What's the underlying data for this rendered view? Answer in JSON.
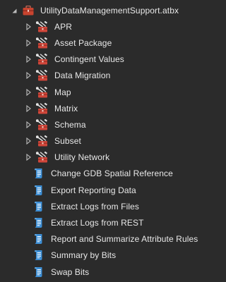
{
  "toolbox": {
    "name": "UtilityDataManagementSupport.atbx",
    "icon": "toolbox-icon",
    "expanded": true
  },
  "toolsets": [
    {
      "label": "APR",
      "icon": "toolset-icon"
    },
    {
      "label": "Asset Package",
      "icon": "toolset-icon"
    },
    {
      "label": "Contingent Values",
      "icon": "toolset-icon"
    },
    {
      "label": "Data Migration",
      "icon": "toolset-icon"
    },
    {
      "label": "Map",
      "icon": "toolset-icon"
    },
    {
      "label": "Matrix",
      "icon": "toolset-icon"
    },
    {
      "label": "Schema",
      "icon": "toolset-icon"
    },
    {
      "label": "Subset",
      "icon": "toolset-icon"
    },
    {
      "label": "Utility Network",
      "icon": "toolset-icon"
    }
  ],
  "scripts": [
    {
      "label": "Change GDB Spatial Reference",
      "icon": "script-tool-icon"
    },
    {
      "label": "Export Reporting Data",
      "icon": "script-tool-icon"
    },
    {
      "label": "Extract Logs from Files",
      "icon": "script-tool-icon"
    },
    {
      "label": "Extract Logs from REST",
      "icon": "script-tool-icon"
    },
    {
      "label": "Report and Summarize Attribute Rules",
      "icon": "script-tool-icon"
    },
    {
      "label": "Summary by Bits",
      "icon": "script-tool-icon"
    },
    {
      "label": "Swap Bits",
      "icon": "script-tool-icon"
    }
  ],
  "colors": {
    "background": "#2b2b2b",
    "text": "#e8e8e8",
    "twisty": "#bdbdbd",
    "toolbox_red": "#c8442f",
    "toolset_red": "#d0463a",
    "script_blue": "#3d8fd6"
  }
}
